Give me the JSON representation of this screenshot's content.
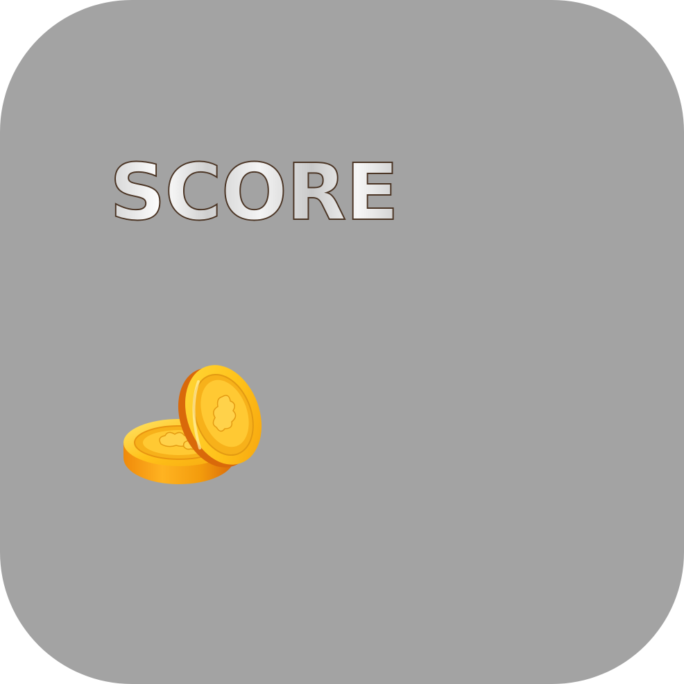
{
  "score": {
    "label": "SCORE"
  },
  "coins": {
    "icon": "coin-stack-icon",
    "colors": {
      "face": "#ffc21a",
      "rim": "#f39b0c",
      "shadow": "#d9690a",
      "highlight": "#ffe56b"
    }
  },
  "panel": {
    "background": "#a3a3a3"
  }
}
